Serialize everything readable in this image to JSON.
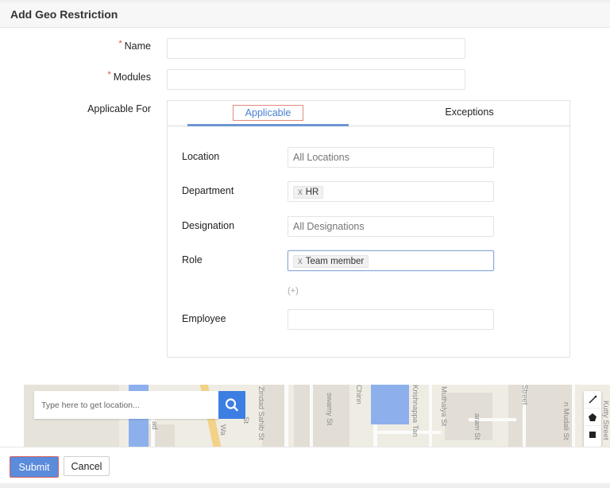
{
  "header": {
    "title": "Add Geo Restriction"
  },
  "form": {
    "required_marker": "*",
    "name": {
      "label": "Name",
      "value": ""
    },
    "modules": {
      "label": "Modules",
      "value": ""
    },
    "applicable_for": {
      "label": "Applicable For"
    }
  },
  "tabs": {
    "items": [
      {
        "label": "Applicable",
        "active": true
      },
      {
        "label": "Exceptions",
        "active": false
      }
    ]
  },
  "filters": {
    "location": {
      "label": "Location",
      "placeholder": "All Locations",
      "value": ""
    },
    "department": {
      "label": "Department",
      "chips": [
        "HR"
      ],
      "remove_glyph": "x"
    },
    "designation": {
      "label": "Designation",
      "placeholder": "All Designations",
      "value": ""
    },
    "role": {
      "label": "Role",
      "chips": [
        "Team member"
      ],
      "remove_glyph": "x"
    },
    "add_more": "(+)",
    "employee": {
      "label": "Employee",
      "value": ""
    }
  },
  "map": {
    "search_placeholder": "Type here to get location...",
    "search_icon": "search-icon",
    "street_labels": [
      "Zindad Sahib St",
      "swamy St",
      "Chinn",
      "Krishnappa Tan",
      "Muthalya St",
      "aram St",
      "Street",
      "n Mudali St",
      "Kutty Street",
      "Wa",
      "ad",
      "St"
    ],
    "tools": [
      "line-draw-icon",
      "polygon-icon",
      "rectangle-icon"
    ],
    "colors": {
      "water": "#8db0ec",
      "search_button": "#3d7ee3"
    }
  },
  "footer": {
    "submit_label": "Submit",
    "cancel_label": "Cancel"
  },
  "colors": {
    "accent": "#4a7fd0",
    "required": "#e0474c",
    "submit_bg": "#5b8bdb"
  }
}
